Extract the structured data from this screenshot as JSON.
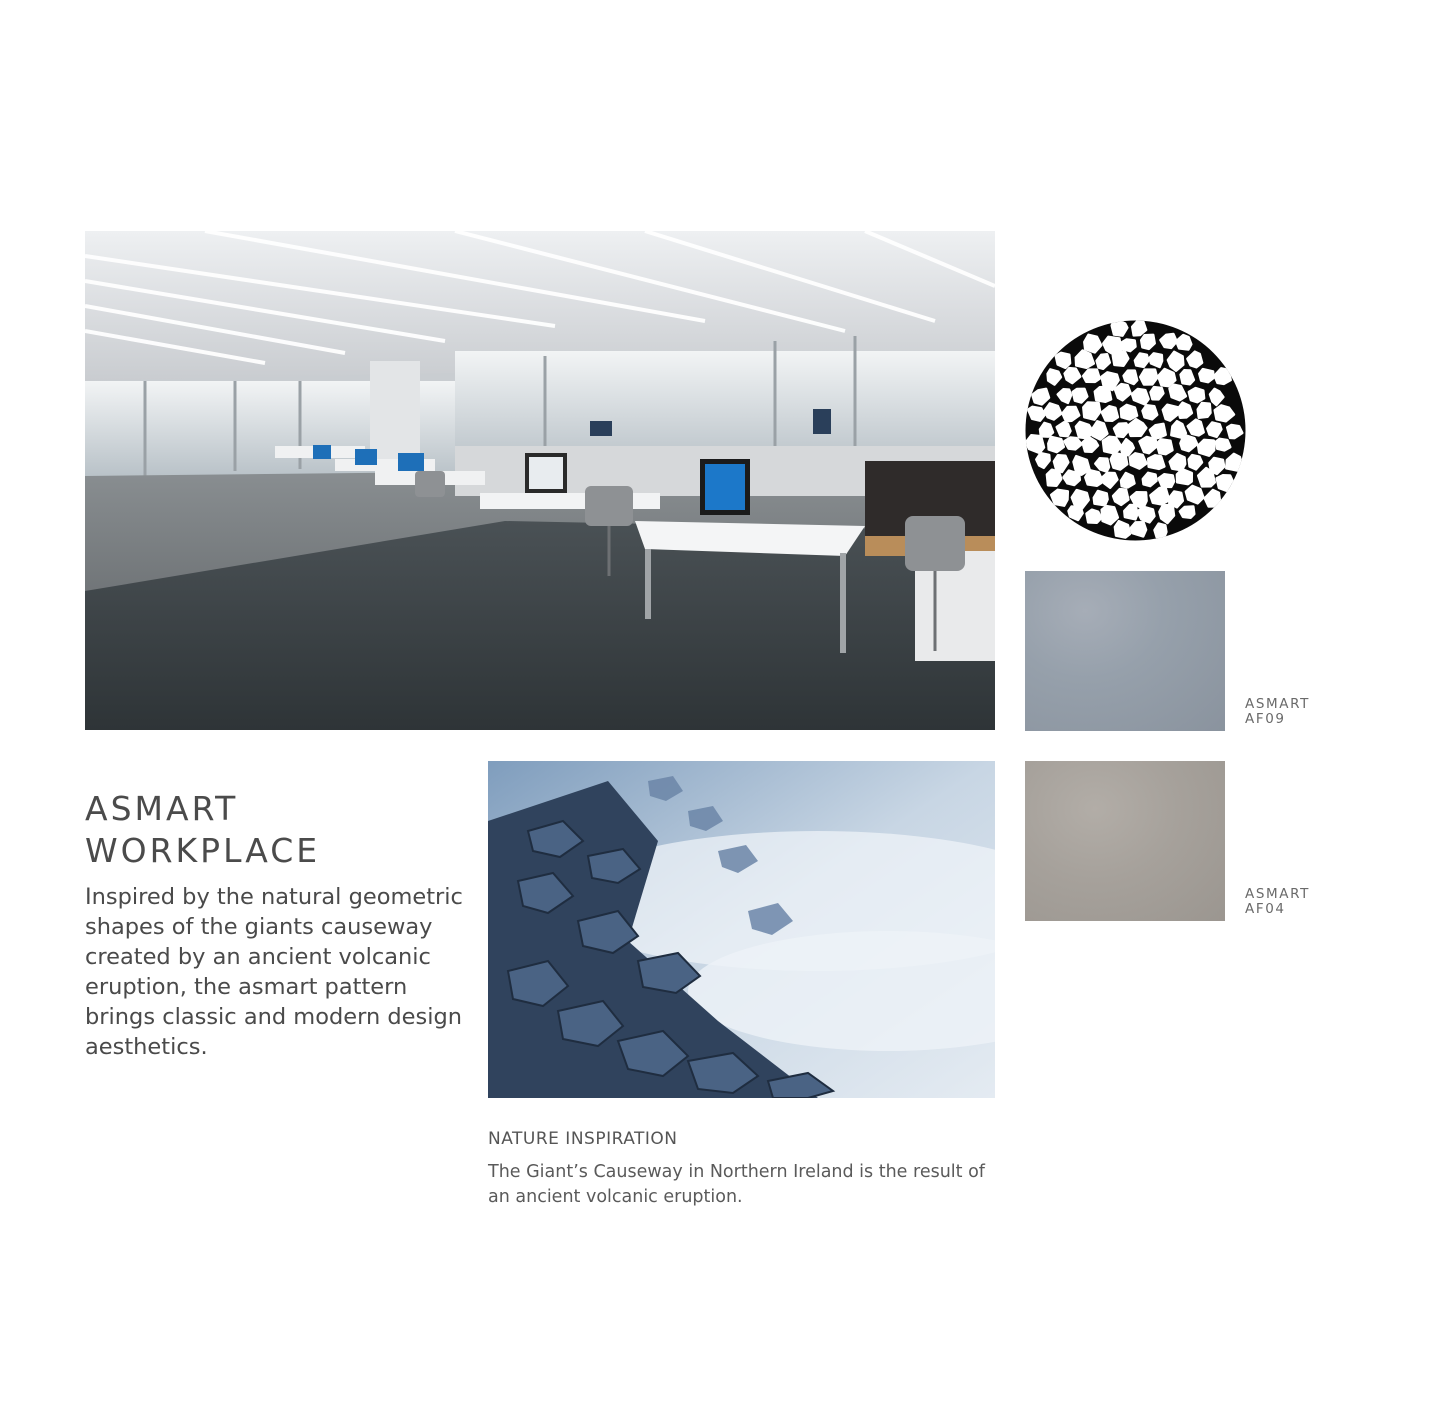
{
  "title": {
    "line1": "ASMART",
    "line2": "WORKPLACE"
  },
  "description": "Inspired by the natural geometric shapes of the giants causeway created by an ancient volcanic eruption, the asmart pattern brings classic and modern design aesthetics.",
  "nature": {
    "heading": "NATURE INSPIRATION",
    "text": "The Giant’s Causeway in Northern Ireland is the result of an ancient volcanic eruption."
  },
  "swatches": [
    {
      "line1": "ASMART",
      "line2": "AF09",
      "color": "#939ca7"
    },
    {
      "line1": "ASMART",
      "line2": "AF04",
      "color": "#a39e98"
    }
  ]
}
